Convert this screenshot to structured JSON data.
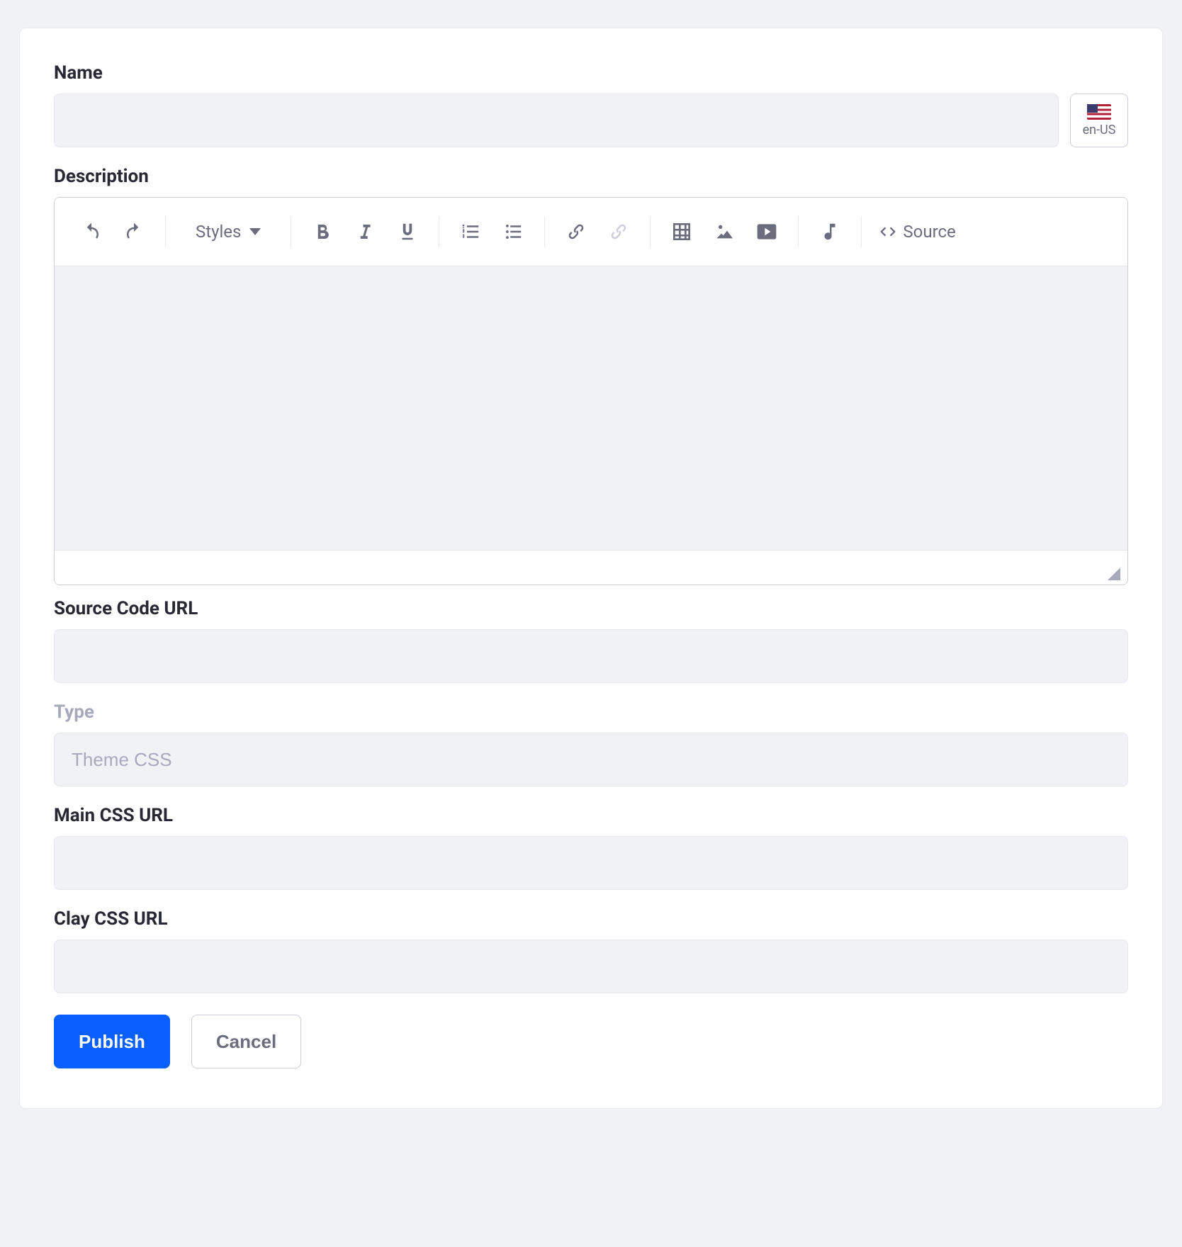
{
  "labels": {
    "name": "Name",
    "description": "Description",
    "source_code_url": "Source Code URL",
    "type": "Type",
    "main_css_url": "Main CSS URL",
    "clay_css_url": "Clay CSS URL"
  },
  "values": {
    "name": "",
    "source_code_url": "",
    "type": "Theme CSS",
    "main_css_url": "",
    "clay_css_url": ""
  },
  "locale": {
    "code": "en-US"
  },
  "editor": {
    "styles_label": "Styles",
    "source_label": "Source"
  },
  "buttons": {
    "publish": "Publish",
    "cancel": "Cancel"
  }
}
